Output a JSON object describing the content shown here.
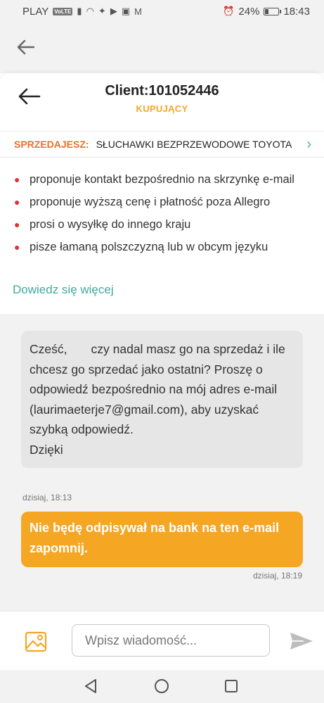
{
  "status_bar": {
    "carrier": "PLAY",
    "volte": "VoLTE",
    "battery": "24%",
    "battery_level": 0.24,
    "time": "18:43"
  },
  "header": {
    "client_title": "Client:101052446",
    "role": "KUPUJĄCY"
  },
  "offer": {
    "label": "SPRZEDAJESZ:",
    "title": "SŁUCHAWKI BEZPRZEWODOWE TOYOTA"
  },
  "warning": {
    "cut_text": "• ... ... ... ... ... ...",
    "items": [
      "proponuje kontakt bezpośrednio na skrzynkę e-mail",
      "proponuje wyższą cenę i płatność poza Allegro",
      "prosi o wysyłkę do innego kraju",
      "pisze łamaną polszczyzną lub w obcym języku"
    ],
    "learn_more": "Dowiedz się więcej"
  },
  "messages": {
    "incoming": {
      "text": "Cześć,       czy nadal masz go na sprzedaż i ile chcesz go sprzedać jako ostatni? Proszę o odpowiedź bezpośrednio na mój adres e-mail (laurimaeterje7@gmail.com), aby uzyskać szybką odpowiedź.\nDzięki",
      "time": "dzisiaj, 18:13"
    },
    "outgoing": {
      "text": "Nie będę odpisywał na bank na ten e-mail zapomnij.",
      "time": "dzisiaj, 18:19"
    }
  },
  "composer": {
    "placeholder": "Wpisz wiadomość..."
  },
  "icons": {
    "back": "arrow-left-icon",
    "chevron": "chevron-right-icon",
    "image": "image-icon",
    "send": "send-icon"
  },
  "colors": {
    "accent_orange": "#f5a623",
    "offer_label": "#e8702a",
    "link_teal": "#3fa9a0",
    "warning_bullet": "#dd3333"
  }
}
